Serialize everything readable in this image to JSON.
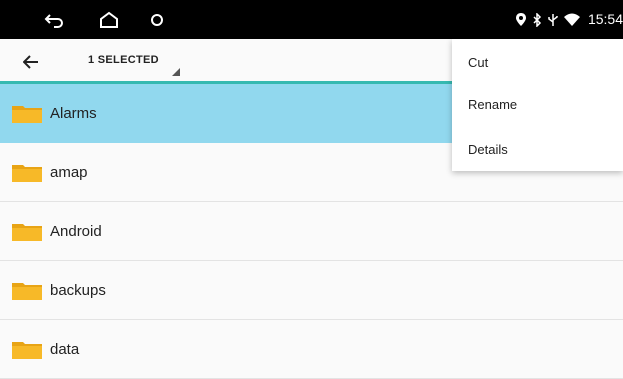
{
  "status_bar": {
    "time": "15:54",
    "icons": [
      "back-nav-icon",
      "home-nav-icon",
      "recents-nav-icon",
      "location-icon",
      "bluetooth-icon",
      "usb-icon",
      "wifi-icon"
    ]
  },
  "toolbar": {
    "selection_text": "1 SELECTED"
  },
  "files": [
    {
      "name": "Alarms",
      "selected": true
    },
    {
      "name": "amap",
      "selected": false
    },
    {
      "name": "Android",
      "selected": false
    },
    {
      "name": "backups",
      "selected": false
    },
    {
      "name": "data",
      "selected": false
    }
  ],
  "menu": {
    "items": [
      "Cut",
      "Rename",
      "Details"
    ]
  },
  "colors": {
    "selected_row": "#91d8ee",
    "accent_line": "#36b9b0",
    "folder": "#f7b928",
    "status_bar": "#000000"
  }
}
